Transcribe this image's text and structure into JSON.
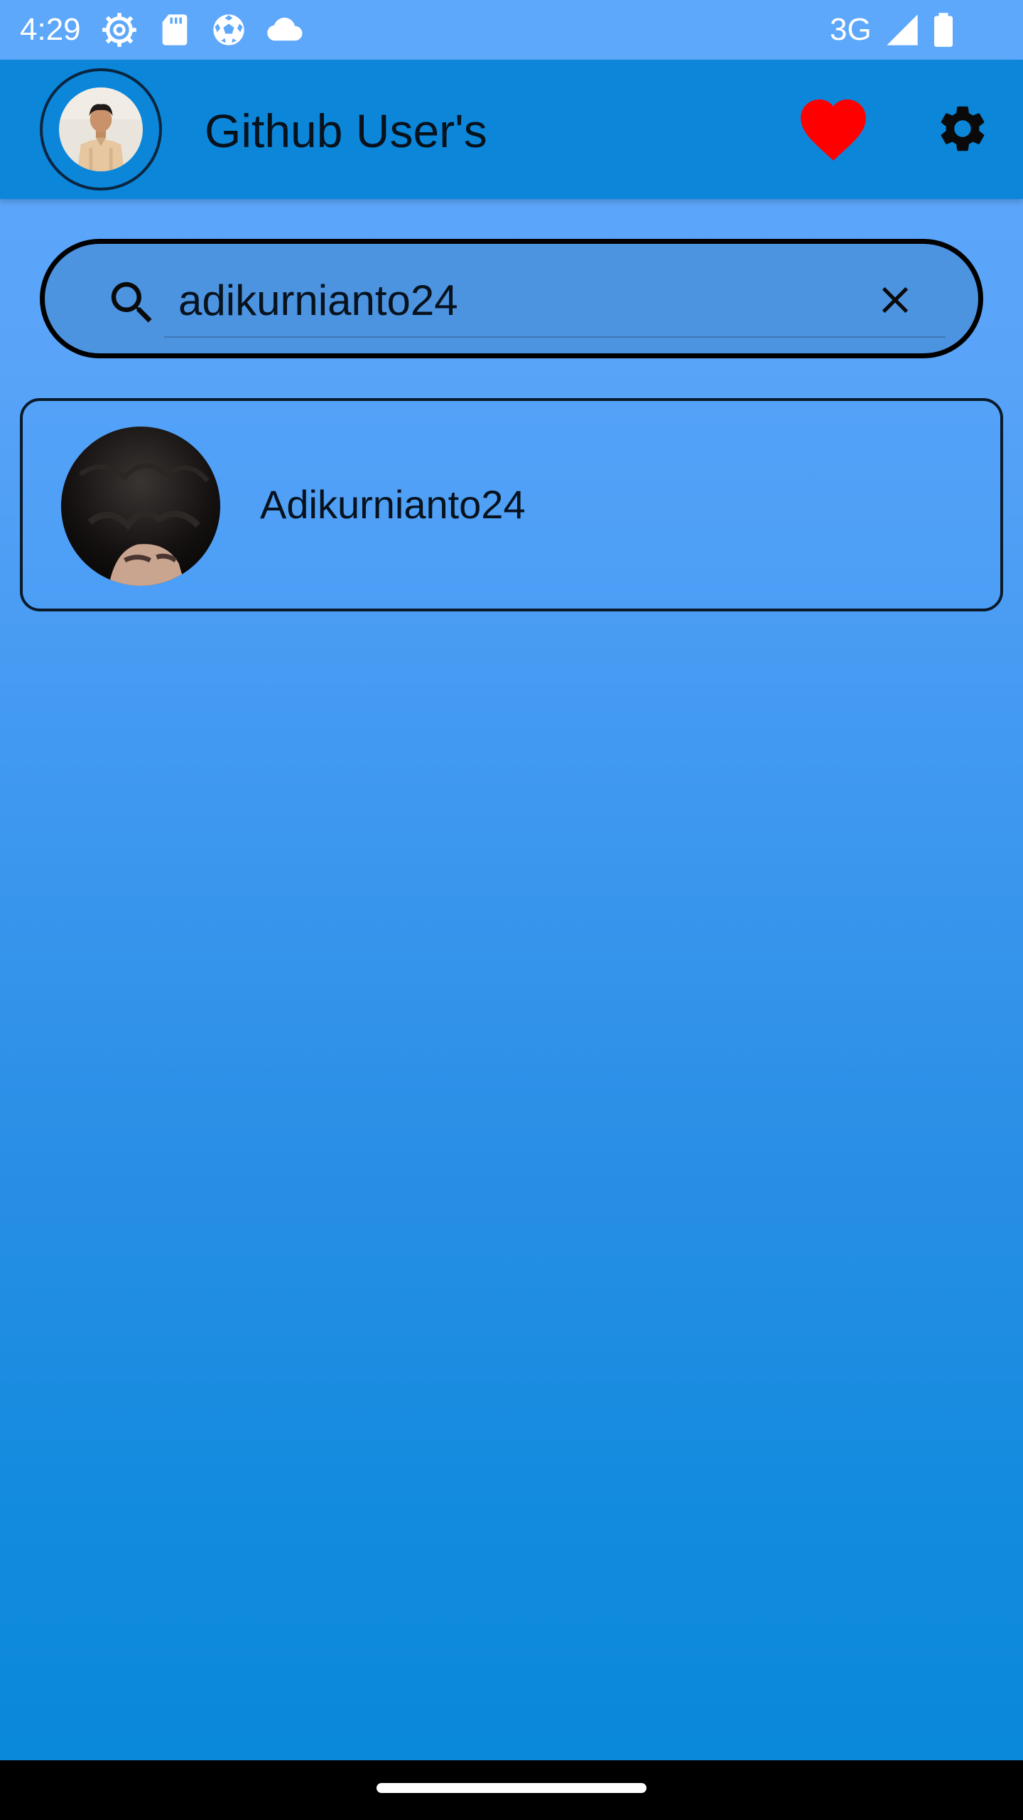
{
  "status_bar": {
    "time": "4:29",
    "network": "3G",
    "icons": [
      "settings-cog-icon",
      "sd-card-icon",
      "soccer-ball-icon",
      "cloud-icon",
      "signal-icon",
      "battery-icon"
    ]
  },
  "app_bar": {
    "title": "Github User's",
    "profile_avatar": "profile-avatar",
    "actions": [
      "heart-icon",
      "gear-icon"
    ]
  },
  "search": {
    "value": "adikurnianto24",
    "icon": "search-icon",
    "clear_icon": "close-icon"
  },
  "results": [
    {
      "username": "Adikurnianto24",
      "avatar": "user-avatar"
    }
  ],
  "colors": {
    "status_bar": "#5ea8fb",
    "app_bar": "#0b86d9",
    "background_top": "#5ea7fb",
    "background_bottom": "#0a88d9",
    "heart": "#ff0000",
    "text": "#07121d"
  }
}
